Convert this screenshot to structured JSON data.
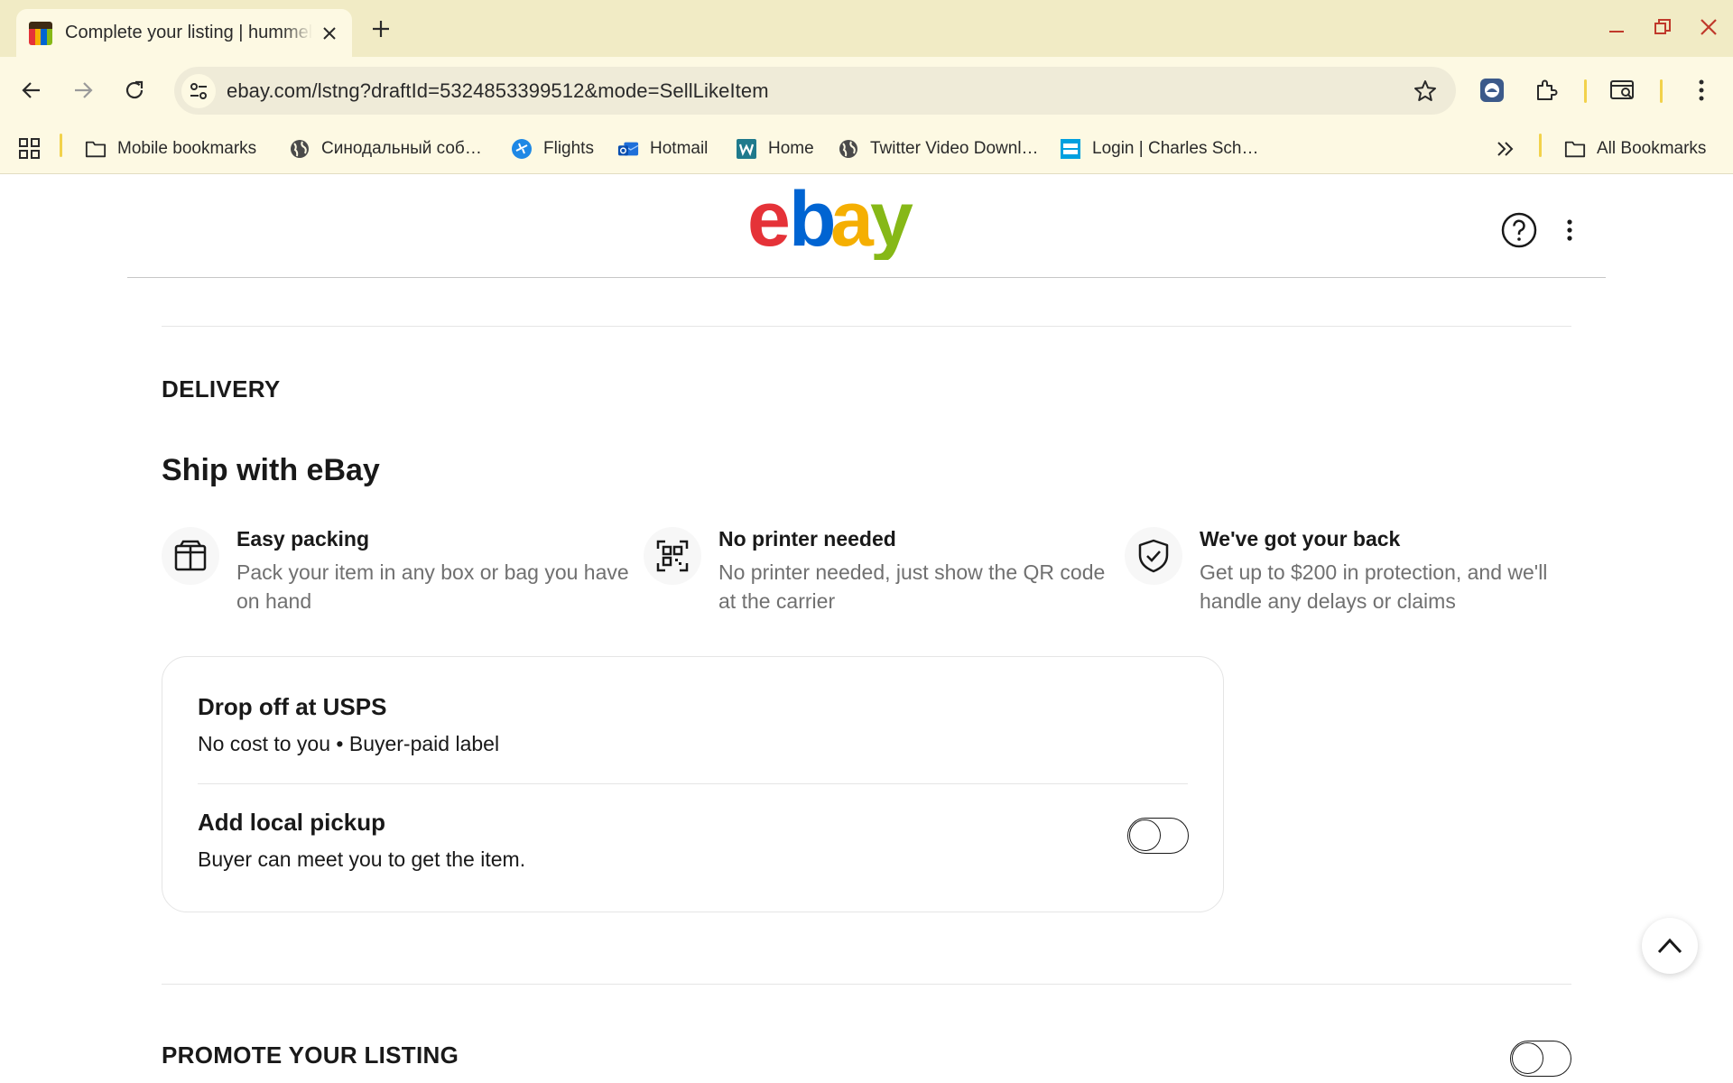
{
  "browser": {
    "tab_title": "Complete your listing | hummel",
    "url": "ebay.com/lstng?draftId=5324853399512&mode=SellLikeItem",
    "bookmarks": [
      {
        "label": "Mobile bookmarks",
        "icon": "folder-icon"
      },
      {
        "label": "Синодальный соб…",
        "icon": "globe-icon"
      },
      {
        "label": "Flights",
        "icon": "flights-icon"
      },
      {
        "label": "Hotmail",
        "icon": "outlook-icon"
      },
      {
        "label": "Home",
        "icon": "home-w-icon"
      },
      {
        "label": "Twitter Video Downl…",
        "icon": "globe-icon"
      },
      {
        "label": "Login | Charles Sch…",
        "icon": "schwab-icon"
      }
    ],
    "all_bookmarks_label": "All Bookmarks"
  },
  "ebay": {
    "logo_letters": [
      "e",
      "b",
      "a",
      "y"
    ],
    "logo_colors": [
      "#e53238",
      "#0064d2",
      "#f5af02",
      "#86b817"
    ]
  },
  "delivery": {
    "section_title": "DELIVERY",
    "ship_title": "Ship with eBay",
    "features": [
      {
        "title": "Easy packing",
        "description": "Pack your item in any box or bag you have on hand",
        "icon": "box-icon"
      },
      {
        "title": "No printer needed",
        "description": "No printer needed, just show the QR code at the carrier",
        "icon": "qr-code-icon"
      },
      {
        "title": "We've got your back",
        "description": "Get up to $200 in protection, and we'll handle any delays or claims",
        "icon": "shield-check-icon"
      }
    ],
    "dropoff_title": "Drop off at USPS",
    "dropoff_subtitle": "No cost to you • Buyer-paid label",
    "local_pickup_title": "Add local pickup",
    "local_pickup_subtitle": "Buyer can meet you to get the item.",
    "local_pickup_enabled": false
  },
  "promote": {
    "section_title": "PROMOTE YOUR LISTING",
    "enabled": false
  },
  "colors": {
    "chrome_bg": "#f1ebc5",
    "toolbar_bg": "#fdf9e3",
    "text_primary": "#191919",
    "text_secondary": "#707070"
  }
}
